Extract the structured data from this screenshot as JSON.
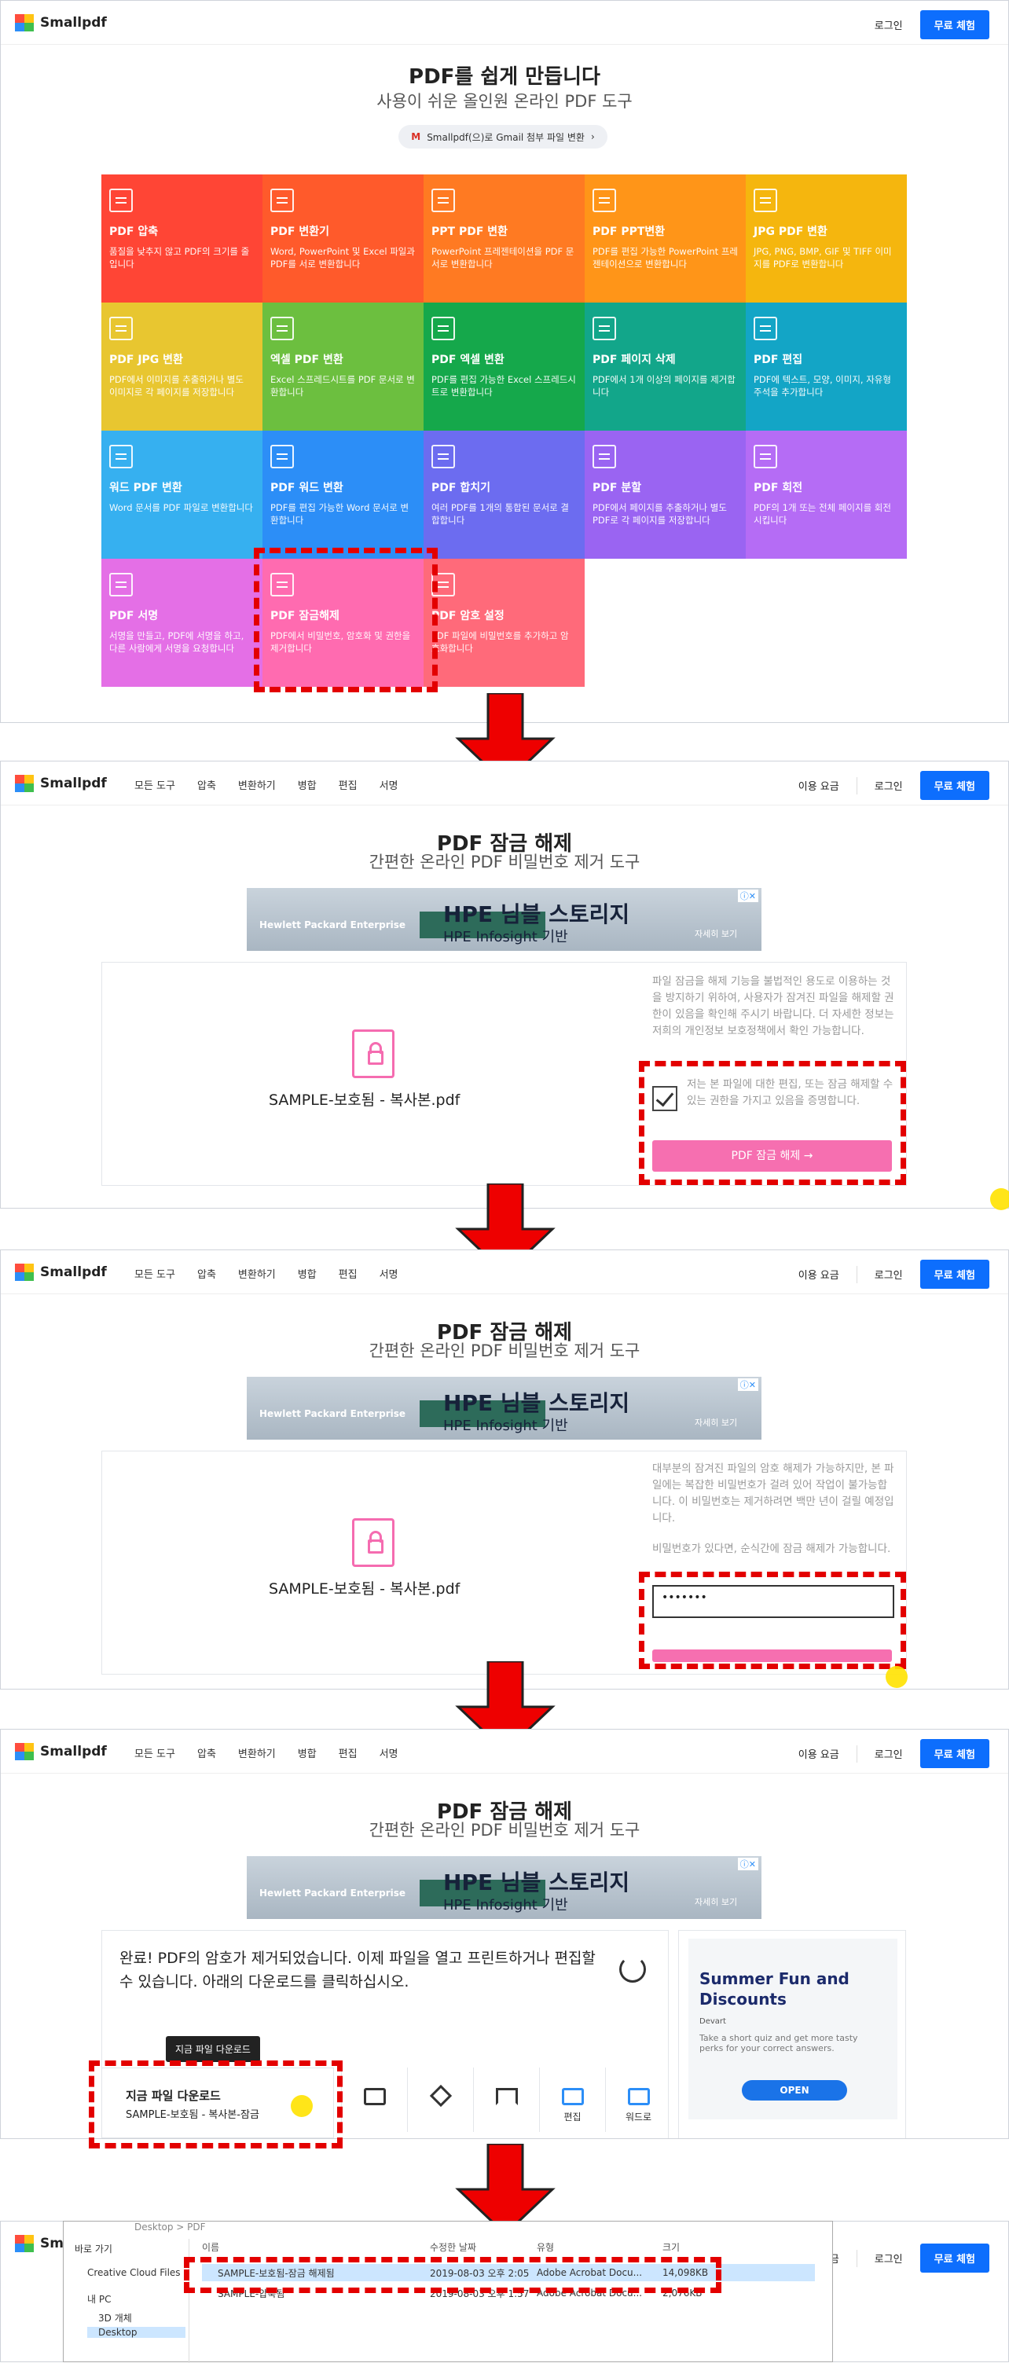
{
  "brand": "Smallpdf",
  "header": {
    "login": "로그인",
    "trial": "무료 체험",
    "pricing": "이용 요금"
  },
  "nav": [
    "모든 도구",
    "압축",
    "변환하기",
    "병합",
    "편집",
    "서명"
  ],
  "home": {
    "title": "PDF를 쉽게 만듭니다",
    "subtitle": "사용이 쉬운 올인원 온라인 PDF 도구",
    "gmail": "Smallpdf(으)로 Gmail 첨부 파일 변환",
    "tools": [
      {
        "title": "PDF 압축",
        "desc": "품질을 낮추지 않고 PDF의 크기를 줄입니다",
        "color": "#ff4535"
      },
      {
        "title": "PDF 변환기",
        "desc": "Word, PowerPoint 및 Excel 파일과 PDF를 서로 변환합니다",
        "color": "#ff5a2b"
      },
      {
        "title": "PPT PDF 변환",
        "desc": "PowerPoint 프레젠테이션을 PDF 문서로 변환합니다",
        "color": "#ff7a22"
      },
      {
        "title": "PDF PPT변환",
        "desc": "PDF를 편집 가능한 PowerPoint 프레젠테이션으로 변환합니다",
        "color": "#ff9518"
      },
      {
        "title": "JPG PDF 변환",
        "desc": "JPG, PNG, BMP, GIF 및 TIFF 이미지를 PDF로 변환합니다",
        "color": "#f5b60e"
      },
      {
        "title": "PDF JPG 변환",
        "desc": "PDF에서 이미지를 추출하거나 별도 이미지로 각 페이지를 저장합니다",
        "color": "#e8c630"
      },
      {
        "title": "엑셀 PDF 변환",
        "desc": "Excel 스프레드시트를 PDF 문서로 변환합니다",
        "color": "#6cbf3f"
      },
      {
        "title": "PDF 엑셀 변환",
        "desc": "PDF를 편집 가능한 Excel 스프레드시트로 변환합니다",
        "color": "#15a84b"
      },
      {
        "title": "PDF 페이지 삭제",
        "desc": "PDF에서 1개 이상의 페이지를 제거합니다",
        "color": "#12a68a"
      },
      {
        "title": "PDF 편집",
        "desc": "PDF에 텍스트, 모양, 이미지, 자유형 주석을 추가합니다",
        "color": "#13a5c6"
      },
      {
        "title": "워드 PDF 변환",
        "desc": "Word 문서를 PDF 파일로 변환합니다",
        "color": "#36b0f0"
      },
      {
        "title": "PDF 워드 변환",
        "desc": "PDF를 편집 가능한 Word 문서로 변환합니다",
        "color": "#2c8ef7"
      },
      {
        "title": "PDF 합치기",
        "desc": "여러 PDF를 1개의 통합된 문서로 결합합니다",
        "color": "#6c6cf0"
      },
      {
        "title": "PDF 분할",
        "desc": "PDF에서 페이지를 추출하거나 별도 PDF로 각 페이지를 저장합니다",
        "color": "#9a64f2"
      },
      {
        "title": "PDF 회전",
        "desc": "PDF의 1개 또는 전체 페이지를 회전시킵니다",
        "color": "#b56cf5"
      },
      {
        "title": "PDF 서명",
        "desc": "서명을 만들고, PDF에 서명을 하고, 다른 사람에게 서명을 요청합니다",
        "color": "#e46fe6"
      },
      {
        "title": "PDF 잠금해제",
        "desc": "PDF에서 비밀번호, 암호화 및 권한을 제거합니다",
        "color": "#ff6bb0"
      },
      {
        "title": "PDF 암호 설정",
        "desc": "PDF 파일에 비밀번호를 추가하고 암호화합니다",
        "color": "#ff6a7a"
      }
    ]
  },
  "unlock": {
    "title": "PDF 잠금 해제",
    "subtitle": "간편한 온라인 PDF 비밀번호 제거 도구",
    "file": "SAMPLE-보호됨 - 복사본.pdf",
    "notice": "파일 잠금을 해제 기능을 불법적인 용도로 이용하는 것을 방지하기 위하여, 사용자가 잠겨진 파일을 해제할 권한이 있음을 확인해 주시기 바랍니다. 더 자세한 정보는 저희의 개인정보 보호정책에서 확인 가능합니다.",
    "consent": "저는 본 파일에 대한 편집, 또는 잠금 해제할 수 있는 권한을 가지고 있음을 증명합니다.",
    "button": "PDF 잠금 해제 →",
    "notice2": "대부분의 잠겨진 파일의 암호 해제가 가능하지만, 본 파일에는 복잡한 비밀번호가 걸려 있어 작업이 불가능합니다. 이 비밀번호는 제거하려면 백만 년이 걸릴 예정입니다.",
    "notice3": "비밀번호가 있다면, 순식간에 잠금 해제가 가능합니다.",
    "password": "•••••••",
    "done": "완료! PDF의 암호가 제거되었습니다. 이제 파일을 열고 프린트하거나 편집할 수 있습니다. 아래의 다운로드를 클릭하십시오.",
    "tooltip": "지금 파일 다운로드",
    "download_title": "지금 파일 다운로드",
    "download_file": "SAMPLE-보호됨 - 복사본-잠금",
    "tools": [
      "편집",
      "워드로"
    ]
  },
  "ad": {
    "company": "Hewlett Packard Enterprise",
    "big": "HPE 님블 스토리지",
    "small": "HPE Infosight 기반",
    "more": "자세히 보기"
  },
  "sidead": {
    "title": "Summer Fun and Discounts",
    "brand": "Devart",
    "desc": "Take a short quiz and get more tasty perks for your correct answers.",
    "button": "OPEN"
  },
  "explorer": {
    "path": "Desktop > PDF",
    "cols": [
      "이름",
      "수정한 날짜",
      "유형",
      "크기"
    ],
    "tree": [
      "바로 가기",
      "Creative Cloud Files",
      "내 PC",
      "3D 개체",
      "Desktop"
    ],
    "rows": [
      {
        "name": "SAMPLE-보호됨-잠금 해제됨",
        "date": "2019-08-03 오후 2:05",
        "type": "Adobe Acrobat Docu...",
        "size": "14,098KB"
      },
      {
        "name": "SAMPLE-압축됨",
        "date": "2019-08-03 오후 1:57",
        "type": "Adobe Acrobat Docu...",
        "size": "2,076KB"
      }
    ]
  }
}
